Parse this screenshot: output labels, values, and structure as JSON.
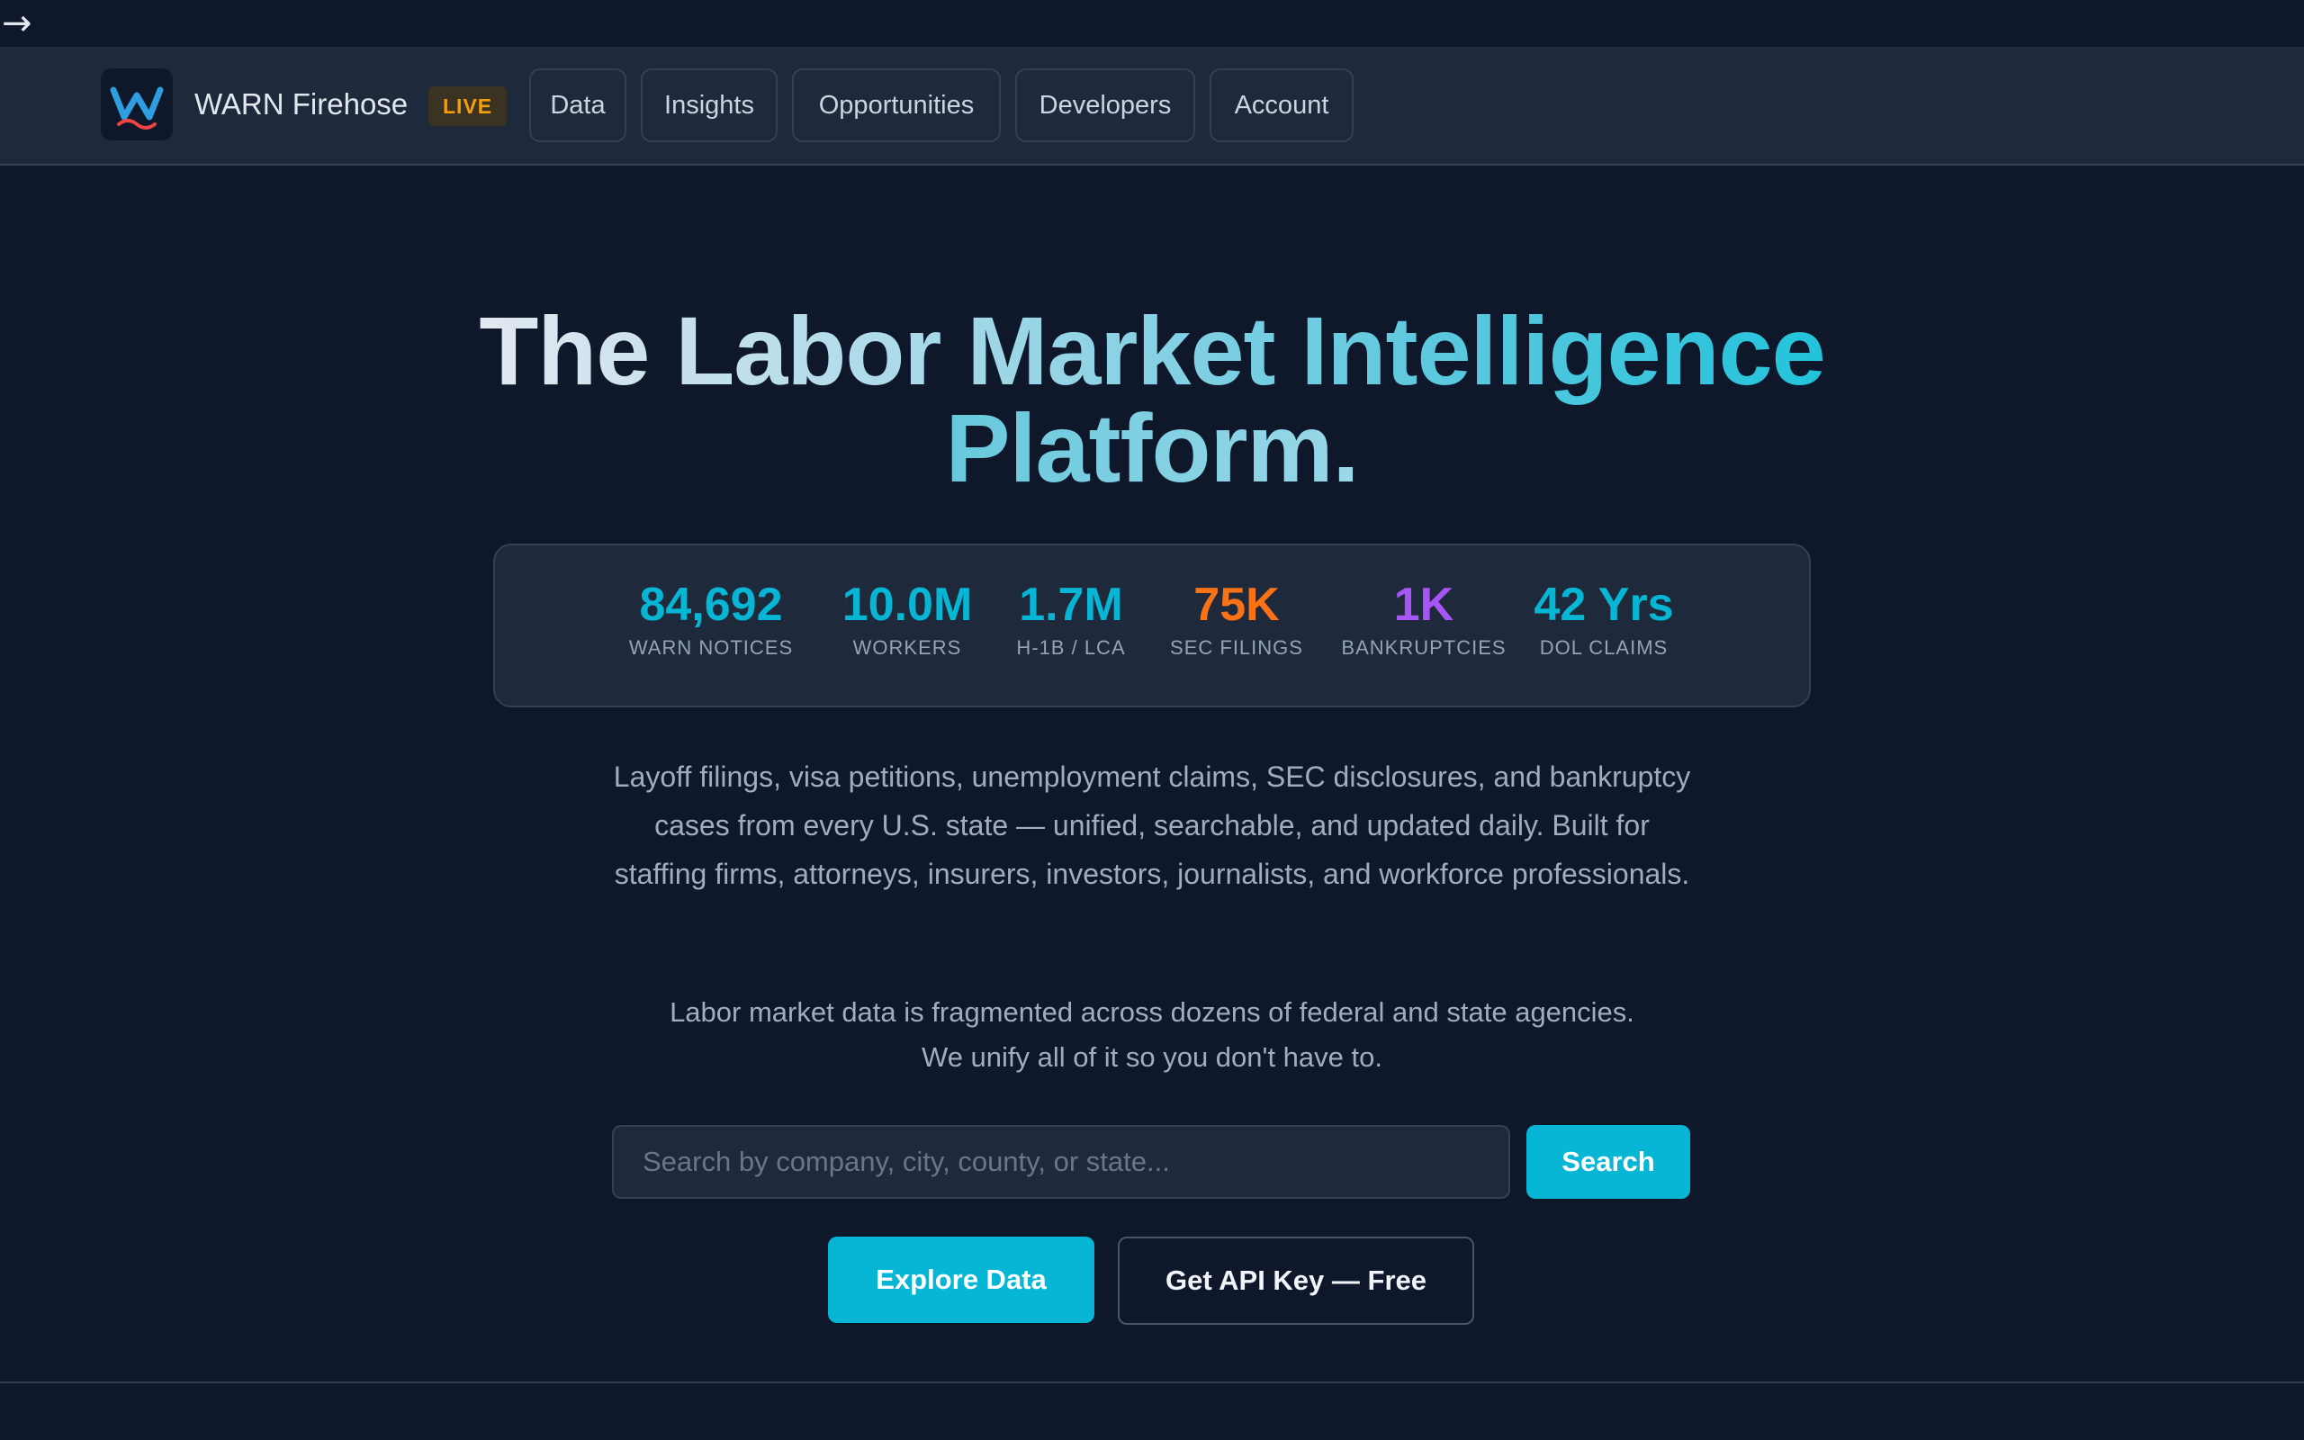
{
  "top": {
    "back_icon": "arrow-right-icon",
    "back_glyph": "→"
  },
  "nav": {
    "brand": "WARN Firehose",
    "badge": "LIVE",
    "logo_icon": "w-wave-logo",
    "items": [
      {
        "label": "Data"
      },
      {
        "label": "Insights"
      },
      {
        "label": "Opportunities"
      },
      {
        "label": "Developers"
      },
      {
        "label": "Account"
      }
    ]
  },
  "hero": {
    "title_line1": "The Labor Market Intelligence",
    "title_line2": "Platform."
  },
  "stats": [
    {
      "value": "84,692",
      "label": "WARN NOTICES",
      "color": "#06b6d4"
    },
    {
      "value": "10.0M",
      "label": "WORKERS",
      "color": "#06b6d4"
    },
    {
      "value": "1.7M",
      "label": "H-1B / LCA",
      "color": "#06b6d4"
    },
    {
      "value": "75K",
      "label": "SEC FILINGS",
      "color": "#f97316"
    },
    {
      "value": "1K",
      "label": "BANKRUPTCIES",
      "color": "#a855f7"
    },
    {
      "value": "42 Yrs",
      "label": "DOL CLAIMS",
      "color": "#06b6d4"
    }
  ],
  "description": "Layoff filings, visa petitions, unemployment claims, SEC disclosures, and bankruptcy cases from every U.S. state — unified, searchable, and updated daily. Built for staffing firms, attorneys, insurers, investors, journalists, and workforce professionals.",
  "description2": "Labor market data is fragmented across dozens of federal and state agencies. We unify all of it so you don't have to.",
  "search": {
    "placeholder": "Search by company, city, county, or state...",
    "value": "",
    "button_label": "Search"
  },
  "cta": {
    "primary_label": "Explore Data",
    "secondary_label": "Get API Key — Free"
  },
  "colors": {
    "background": "#0f172a",
    "surface": "#1e293b",
    "accent": "#06b6d4",
    "orange": "#f97316",
    "purple": "#a855f7",
    "badge": "#f59e0b"
  }
}
